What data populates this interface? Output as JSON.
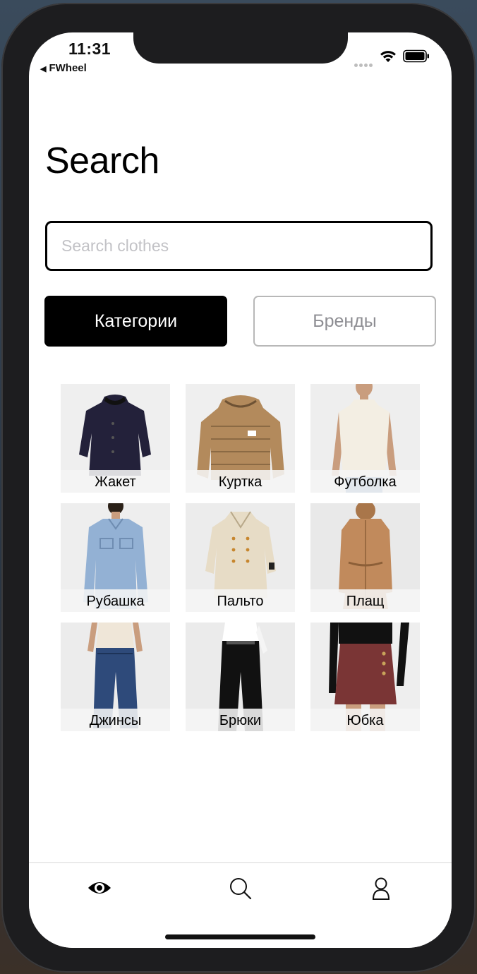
{
  "status_bar": {
    "time": "11:31",
    "back_app": "FWheel",
    "icons": [
      "cellular-dots-icon",
      "wifi-icon",
      "battery-icon"
    ]
  },
  "page": {
    "title": "Search"
  },
  "search": {
    "placeholder": "Search clothes",
    "value": ""
  },
  "segments": {
    "active_label": "Категории",
    "inactive_label": "Бренды",
    "active_color": "#000000",
    "inactive_text_color": "#8e8e93"
  },
  "categories": [
    {
      "label": "Жакет"
    },
    {
      "label": "Куртка"
    },
    {
      "label": "Футболка"
    },
    {
      "label": "Рубашка"
    },
    {
      "label": "Пальто"
    },
    {
      "label": "Плащ"
    },
    {
      "label": "Джинсы"
    },
    {
      "label": "Брюки"
    },
    {
      "label": "Юбка"
    }
  ],
  "tab_bar": {
    "items": [
      "eye-icon",
      "search-icon",
      "person-icon"
    ],
    "selected": "eye-icon"
  }
}
